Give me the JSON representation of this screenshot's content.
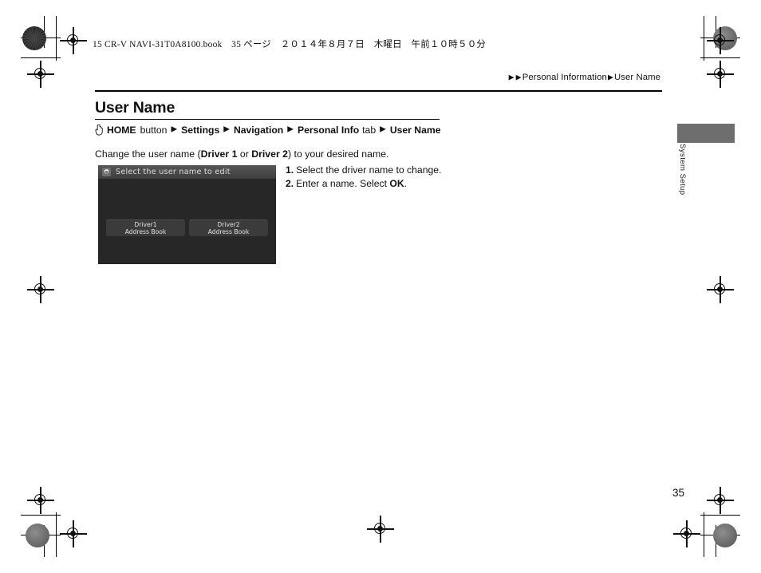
{
  "print_header": {
    "book_line": "15 CR-V NAVI-31T0A8100.book　35 ページ　２０１４年８月７日　木曜日　午前１０時５０分"
  },
  "breadcrumb": {
    "arrow_glyph": "▶",
    "section": "Personal Information",
    "page": "User Name"
  },
  "header": {
    "title": "User Name"
  },
  "nav_path": {
    "hand_icon_name": "pointing-hand-icon",
    "separator_glyph": "▶",
    "items": [
      {
        "label": "HOME",
        "bold": true
      },
      {
        "label": "button",
        "bold": false
      },
      {
        "label": "Settings",
        "bold": true
      },
      {
        "label": "Navigation",
        "bold": true
      },
      {
        "label": "Personal Info",
        "bold": true
      },
      {
        "label": "tab",
        "bold": false
      },
      {
        "label": "User Name",
        "bold": true
      }
    ]
  },
  "body": {
    "intro_prefix": "Change the user name (",
    "driver1_label": "Driver 1",
    "intro_middle": " or ",
    "driver2_label": "Driver 2",
    "intro_suffix": ") to your desired name."
  },
  "steps": [
    {
      "num": "1.",
      "text": "Select the driver name to change.",
      "bold_tail": ""
    },
    {
      "num": "2.",
      "text": "Enter a name. Select ",
      "bold_tail": "OK",
      "tail_suffix": "."
    }
  ],
  "device_screen": {
    "icon_name": "gear-icon",
    "title": "Select the user name to edit",
    "buttons": [
      {
        "line1": "Driver1",
        "line2": "Address Book"
      },
      {
        "line1": "Driver2",
        "line2": "Address Book"
      }
    ],
    "background_color": "#272727",
    "titlebar_color": "#4a4a4a",
    "button_color": "#3b3b3b"
  },
  "side_tab": {
    "label": "System Setup",
    "block_color": "#6e6e6e"
  },
  "footer": {
    "page_number": "35"
  }
}
